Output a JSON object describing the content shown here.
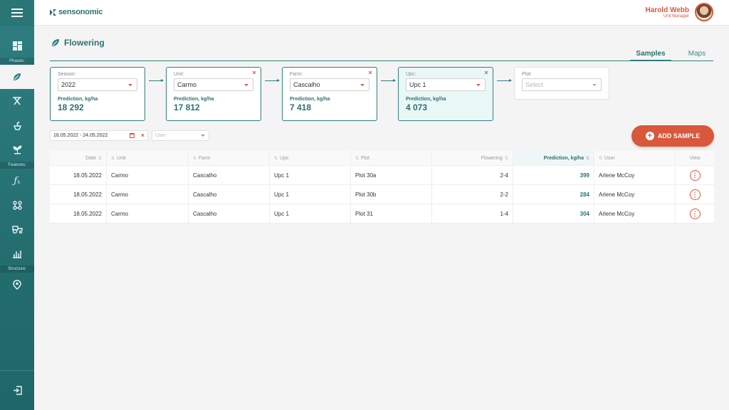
{
  "header": {
    "brand": "sensonomic",
    "user_name": "Harold Webb",
    "user_role": "Unit Manager"
  },
  "sidebar": {
    "sections": [
      "Phases:",
      "Features:",
      "Structure:"
    ],
    "items": [
      {
        "icon": "dashboard-icon"
      },
      {
        "icon": "leaf-icon",
        "active": true
      },
      {
        "icon": "scissors-icon"
      },
      {
        "icon": "sprout-pot-icon"
      },
      {
        "icon": "seedling-icon"
      },
      {
        "icon": "function-icon"
      },
      {
        "icon": "network-icon"
      },
      {
        "icon": "tractor-icon"
      },
      {
        "icon": "chart-plant-icon"
      },
      {
        "icon": "map-pin-icon"
      },
      {
        "icon": "logout-icon"
      }
    ]
  },
  "page": {
    "title": "Flowering",
    "tabs": [
      "Samples",
      "Maps"
    ],
    "active_tab": "Samples"
  },
  "filters": [
    {
      "label": "Season:",
      "value": "2022",
      "pred_label": "Prediction, kg/ha",
      "pred_value": "18 292"
    },
    {
      "label": "Unit:",
      "value": "Carmo",
      "pred_label": "Prediction, kg/ha",
      "pred_value": "17 812"
    },
    {
      "label": "Farm:",
      "value": "Cascalho",
      "pred_label": "Prediction, kg/ha",
      "pred_value": "7 418"
    },
    {
      "label": "Upc:",
      "value": "Upc 1",
      "pred_label": "Prediction, kg/ha",
      "pred_value": "4 073"
    },
    {
      "label": "Plot:",
      "placeholder": "Select"
    }
  ],
  "date_filter": {
    "value": "18.05.2022 - 24.05.2022"
  },
  "user_filter": {
    "placeholder": "User"
  },
  "add_button": {
    "label": "ADD SAMPLE"
  },
  "table": {
    "columns": [
      "Date",
      "Unit",
      "Farm",
      "Upc",
      "Plot",
      "Flowering",
      "Prediction, kg/ha",
      "User",
      "View"
    ],
    "rows": [
      [
        "18.05.2022",
        "Carmo",
        "Cascalho",
        "Upc 1",
        "Plot 30a",
        "2-4",
        "399",
        "Arlene McCoy"
      ],
      [
        "18.05.2022",
        "Carmo",
        "Cascalho",
        "Upc 1",
        "Plot 30b",
        "2-2",
        "284",
        "Arlene McCoy"
      ],
      [
        "18.05.2022",
        "Carmo",
        "Cascalho",
        "Upc 1",
        "Plot 31",
        "1-4",
        "304",
        "Arlene McCoy"
      ]
    ]
  },
  "colors": {
    "primary": "#2f7f80",
    "accent": "#d9573b"
  }
}
